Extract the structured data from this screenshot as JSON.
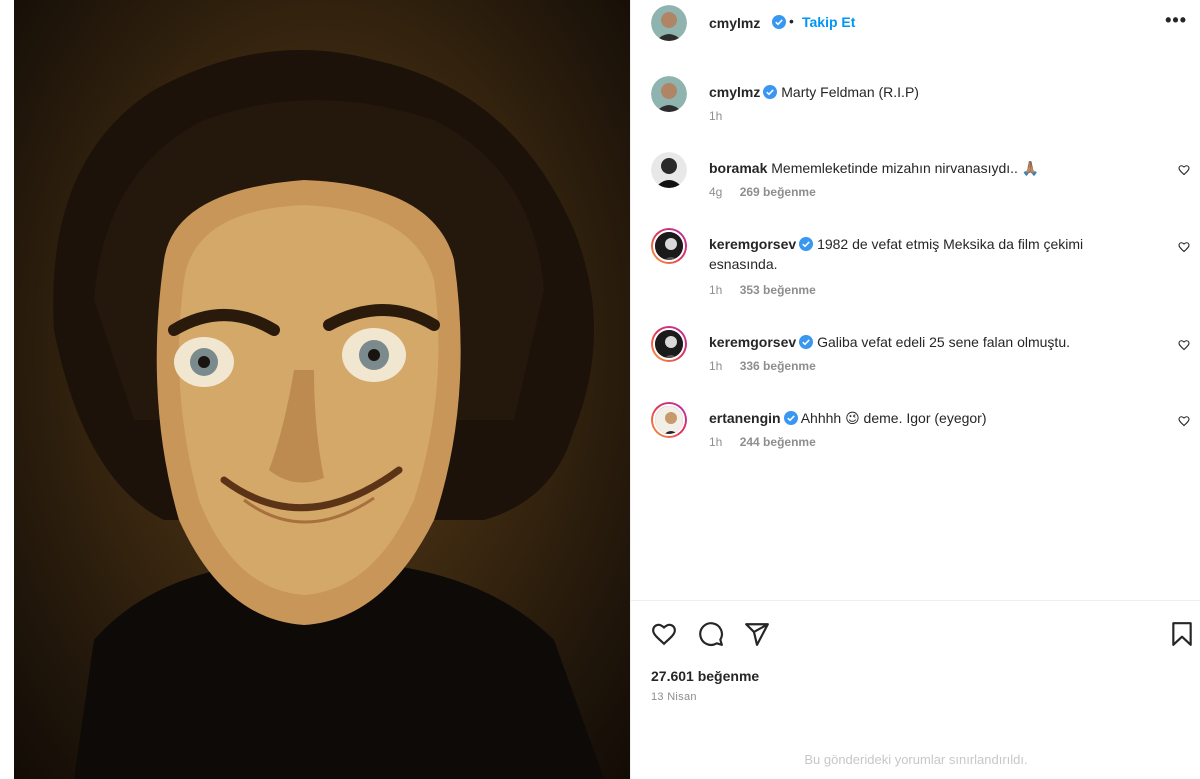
{
  "post": {
    "author": "cmylmz",
    "follow_label": "Takip Et",
    "dot": "•",
    "more_label": "•••",
    "caption": "Marty Feldman (R.I.P)",
    "caption_time": "1h"
  },
  "comments": [
    {
      "user": "boramak",
      "verified": false,
      "text": "Mememleketinde mizahın nirvanasıydı.. 🙏🏽",
      "time": "4g",
      "likes": "269 beğenme"
    },
    {
      "user": "keremgorsev",
      "verified": true,
      "text": "1982 de vefat etmiş Meksika da film çekimi esnasında.",
      "time": "1h",
      "likes": "353 beğenme"
    },
    {
      "user": "keremgorsev",
      "verified": true,
      "text": "Galiba vefat edeli 25 sene falan olmuştu.",
      "time": "1h",
      "likes": "336 beğenme"
    },
    {
      "user": "ertanengin",
      "verified": true,
      "text": "Ahhhh 😉 deme. Igor (eyegor)",
      "time": "1h",
      "likes": "244 beğenme"
    }
  ],
  "footer": {
    "likes_total": "27.601 beğenme",
    "date": "13 Nisan",
    "comments_limited": "Bu gönderideki yorumlar sınırlandırıldı."
  },
  "colors": {
    "accent": "#0095f6",
    "verified": "#3897f0",
    "text": "#262626",
    "muted": "#8e8e8e"
  }
}
